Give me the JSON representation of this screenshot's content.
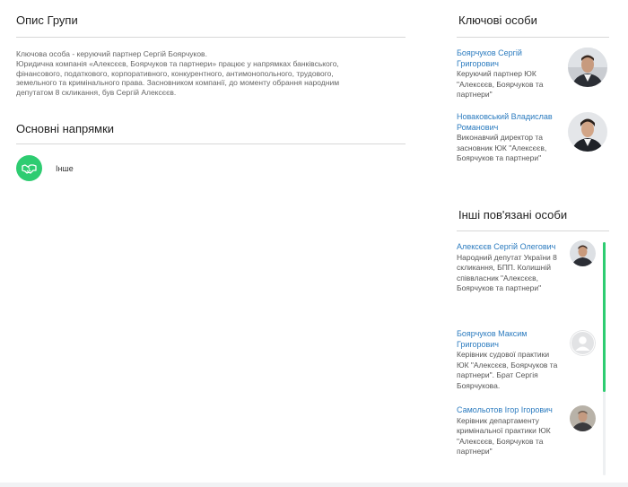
{
  "group": {
    "title": "Опис Групи",
    "description_lines": [
      "Ключова особа - керуючий партнер Сергій Боярчуков.",
      "Юридична компанія «Алексєєв, Боярчуков та партнери» працює у напрямках банківського,",
      "фінансового, податкового, корпоративного, конкурентного, антимонопольного, трудового,",
      "земельного та кримінального права. Засновником компанії, до моменту обрання народним",
      "депутатом 8 скликання, був Сергій Алексєєв."
    ]
  },
  "directions": {
    "title": "Основні напрямки",
    "items": [
      {
        "label": "Інше",
        "icon": "handshake-icon",
        "color": "#2ecc71"
      }
    ]
  },
  "key_persons": {
    "title": "Ключові особи",
    "items": [
      {
        "name": "Боярчуков Сергій Григорович",
        "role": "Керуючий партнер ЮК \"Алексєєв, Боярчуков та партнери\"",
        "avatar": "photo"
      },
      {
        "name": "Новаковський Владислав Романович",
        "role": "Виконавчий директор та засновник ЮК \"Алексєєв, Боярчуков та партнери\"",
        "avatar": "photo"
      }
    ]
  },
  "other_persons": {
    "title": "Інші пов'язані особи",
    "items": [
      {
        "name": "Алексєєв Сергій Олегович",
        "role": "Народний депутат України 8 скликання, БПП. Колишній співвласник \"Алексєєв, Боярчуков та партнери\"",
        "avatar": "photo"
      },
      {
        "name": "Боярчуков Максим Григорович",
        "role": "Керівник судової практики ЮК \"Алексєєв, Боярчуков та партнери\". Брат Сергія Боярчукова.",
        "avatar": "placeholder"
      },
      {
        "name": "Самольотов Ігор Ігорович",
        "role": "Керівник департаменту кримінальної практики ЮК \"Алексєєв, Боярчуков та партнери\"",
        "avatar": "photo"
      }
    ]
  },
  "colors": {
    "link": "#2b7bbf",
    "accent": "#2ecc71"
  }
}
